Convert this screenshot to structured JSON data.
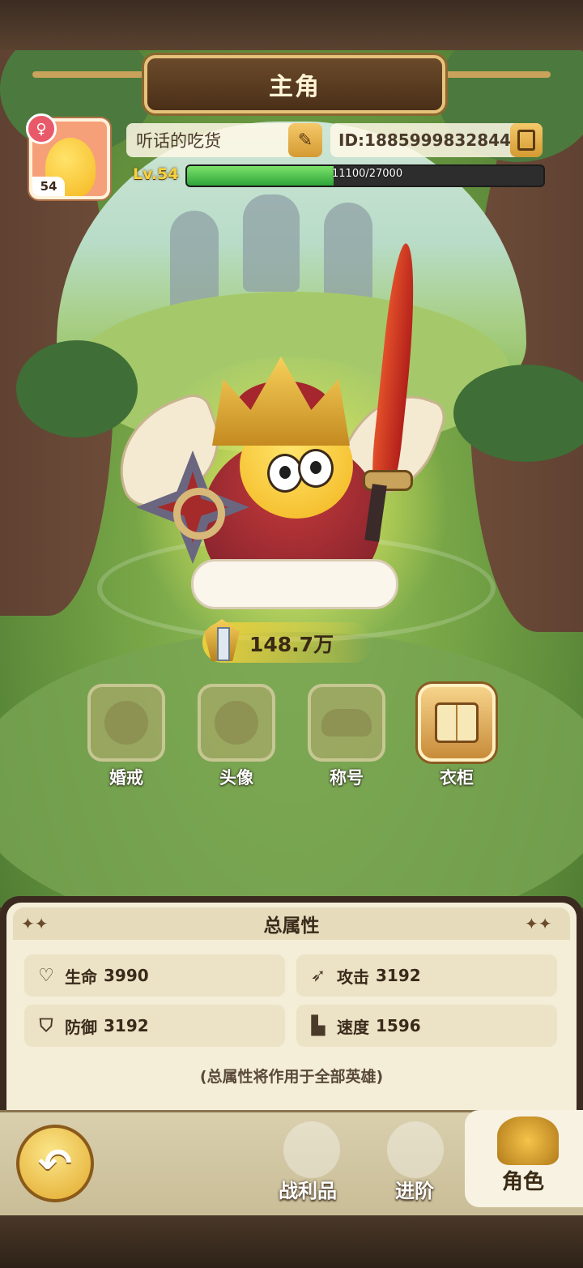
{
  "header": {
    "title": "主角"
  },
  "profile": {
    "avatar_level": "54",
    "gender_symbol": "♀",
    "name": "听话的吃货",
    "id_text": "ID:1885999832844",
    "level_label": "Lv.54",
    "xp_current": 11100,
    "xp_max": 27000,
    "xp_text": "11100/27000"
  },
  "power": {
    "value": "148.7万"
  },
  "functions": [
    {
      "label": "婚戒",
      "active": false
    },
    {
      "label": "头像",
      "active": false
    },
    {
      "label": "称号",
      "active": false
    },
    {
      "label": "衣柜",
      "active": true
    }
  ],
  "stats_panel": {
    "title": "总属性",
    "stats": [
      {
        "name": "生命",
        "value": "3990",
        "icon": "heart-icon"
      },
      {
        "name": "攻击",
        "value": "3192",
        "icon": "attack-icon"
      },
      {
        "name": "防御",
        "value": "3192",
        "icon": "shield-icon"
      },
      {
        "name": "速度",
        "value": "1596",
        "icon": "boot-icon"
      }
    ],
    "note": "(总属性将作用于全部英雄)"
  },
  "nav": {
    "items": [
      {
        "label": "战利品",
        "active": false
      },
      {
        "label": "进阶",
        "active": false
      },
      {
        "label": "角色",
        "active": true
      }
    ]
  }
}
